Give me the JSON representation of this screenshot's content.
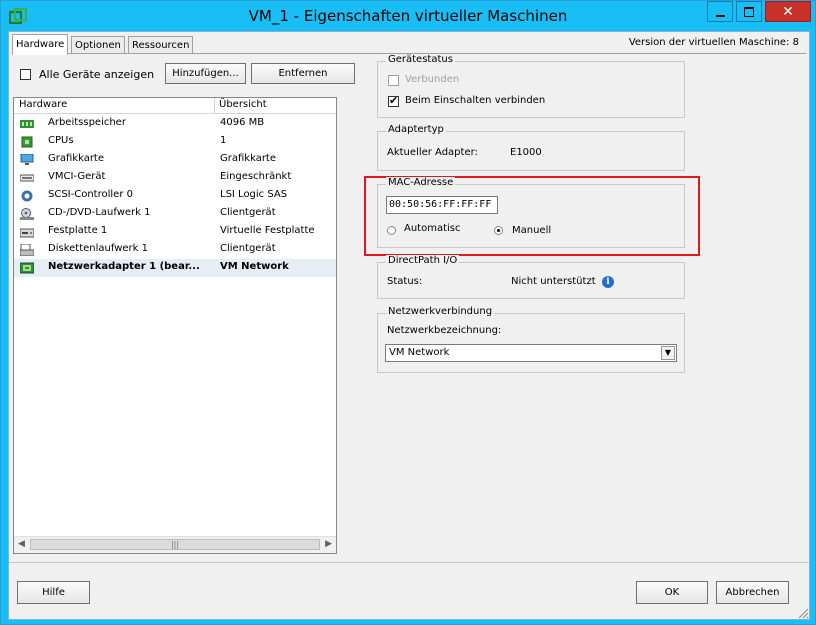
{
  "window": {
    "title": "VM_1 - Eigenschaften virtueller Maschinen"
  },
  "tabs": [
    {
      "label": "Hardware",
      "active": true
    },
    {
      "label": "Optionen",
      "active": false
    },
    {
      "label": "Ressourcen",
      "active": false
    }
  ],
  "version_text": "Version der virtuellen Maschine: 8",
  "toolbar": {
    "show_all_label": "Alle Geräte anzeigen",
    "add_label": "Hinzufügen...",
    "remove_label": "Entfernen"
  },
  "hardware_list": {
    "columns": [
      "Hardware",
      "Übersicht"
    ],
    "rows": [
      {
        "name": "Arbeitsspeicher",
        "summary": "4096 MB",
        "icon": "memory-icon"
      },
      {
        "name": "CPUs",
        "summary": "1",
        "icon": "cpu-icon"
      },
      {
        "name": "Grafikkarte",
        "summary": "Grafikkarte",
        "icon": "monitor-icon"
      },
      {
        "name": "VMCI-Gerät",
        "summary": "Eingeschränkt",
        "icon": "vmci-icon"
      },
      {
        "name": "SCSI-Controller 0",
        "summary": "LSI Logic SAS",
        "icon": "scsi-icon"
      },
      {
        "name": "CD-/DVD-Laufwerk 1",
        "summary": "Clientgerät",
        "icon": "cdrom-icon"
      },
      {
        "name": "Festplatte 1",
        "summary": "Virtuelle Festplatte",
        "icon": "harddisk-icon"
      },
      {
        "name": "Diskettenlaufwerk 1",
        "summary": "Clientgerät",
        "icon": "floppy-icon"
      },
      {
        "name": "Netzwerkadapter 1 (bear...",
        "summary": "VM Network",
        "icon": "network-icon",
        "selected": true
      }
    ]
  },
  "device_status": {
    "legend": "Gerätestatus",
    "connected_label": "Verbunden",
    "connect_at_power_on_label": "Beim Einschalten verbinden"
  },
  "adapter_type": {
    "legend": "Adaptertyp",
    "current_label": "Aktueller Adapter:",
    "current_value": "E1000"
  },
  "mac": {
    "legend": "MAC-Adresse",
    "value": "00:50:56:FF:FF:FF",
    "automatic_label": "Automatisc",
    "manual_label": "Manuell"
  },
  "directpath": {
    "legend": "DirectPath I/O",
    "status_label": "Status:",
    "status_value": "Nicht unterstützt"
  },
  "network_connection": {
    "legend": "Netzwerkverbindung",
    "label_label": "Netzwerkbezeichnung:",
    "selected": "VM Network"
  },
  "footer": {
    "help_label": "Hilfe",
    "ok_label": "OK",
    "cancel_label": "Abbrechen"
  },
  "colors": {
    "titlebar": "#19bef6",
    "close": "#c7312a",
    "highlight": "#e3161c",
    "selected_row": "#e6edf5"
  }
}
